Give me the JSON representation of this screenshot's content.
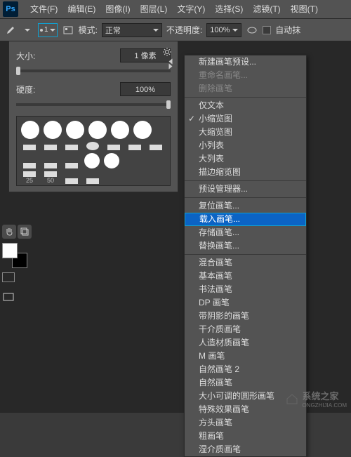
{
  "menubar": {
    "items": [
      "文件(F)",
      "编辑(E)",
      "图像(I)",
      "图层(L)",
      "文字(Y)",
      "选择(S)",
      "滤镜(T)",
      "视图(T)"
    ]
  },
  "optbar": {
    "brush_size": "1",
    "mode_label": "模式:",
    "mode_value": "正常",
    "opacity_label": "不透明度:",
    "opacity_value": "100%",
    "auto_erase_label": "自动抹"
  },
  "brush_panel": {
    "size_label": "大小:",
    "size_value": "1 像素",
    "hardness_label": "硬度:",
    "hardness_value": "100%",
    "row3_sizes": [
      "25",
      "50"
    ]
  },
  "ctx": {
    "new_preset": "新建画笔预设...",
    "rename": "重命名画笔...",
    "delete": "删除画笔",
    "text_only": "仅文本",
    "small_thumb": "小缩览图",
    "large_thumb": "大缩览图",
    "small_list": "小列表",
    "large_list": "大列表",
    "stroke_thumb": "描边缩览图",
    "preset_mgr": "预设管理器...",
    "reset": "复位画笔...",
    "load": "载入画笔...",
    "save": "存储画笔...",
    "replace": "替换画笔...",
    "mixed": "混合画笔",
    "basic": "基本画笔",
    "callig": "书法画笔",
    "dp": "DP 画笔",
    "shadow": "带阴影的画笔",
    "dry": "干介质画笔",
    "faux": "人造材质画笔",
    "m": "M 画笔",
    "nat2": "自然画笔 2",
    "nat": "自然画笔",
    "round": "大小可调的圆形画笔",
    "fx": "特殊效果画笔",
    "square": "方头画笔",
    "thick": "粗画笔",
    "wet": "湿介质画笔"
  },
  "watermark": {
    "text": "系统之家",
    "url": "ONGZHIJIA.COM"
  }
}
